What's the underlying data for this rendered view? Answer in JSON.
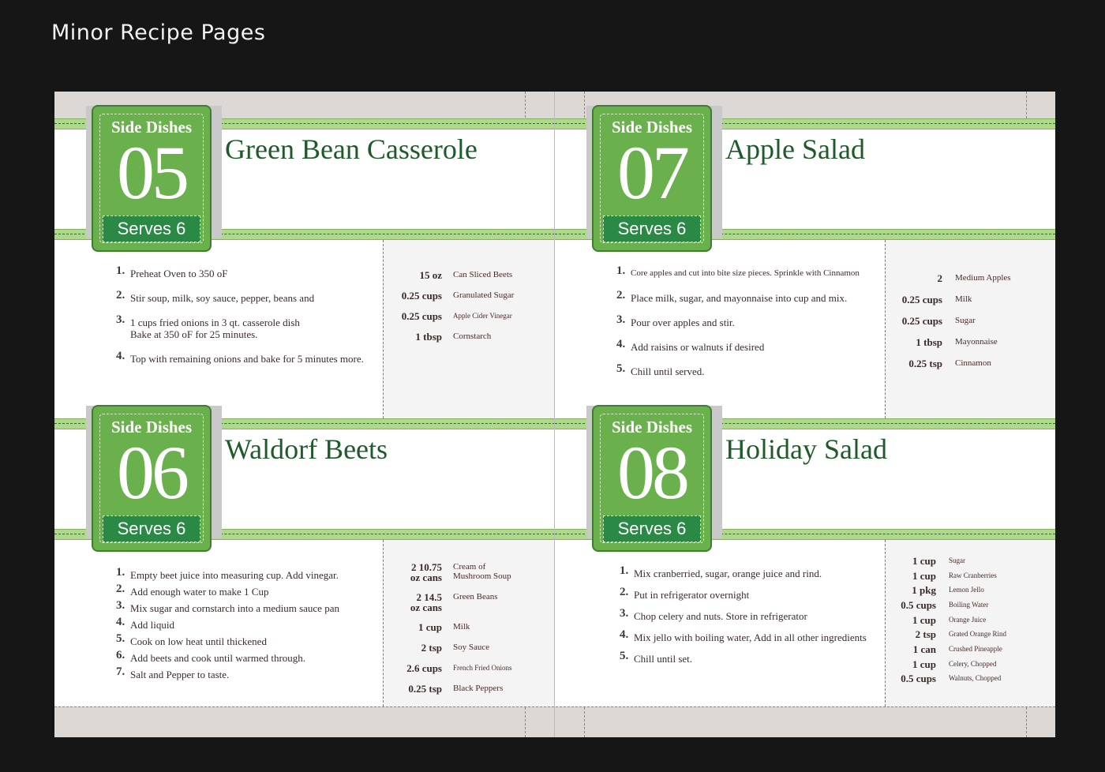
{
  "page_title": "Minor Recipe Pages",
  "recipes": [
    {
      "category": "Side Dishes",
      "number": "05",
      "serves": "Serves 6",
      "title": "Green Bean Casserole",
      "steps": [
        {
          "n": "1.",
          "text": "Preheat Oven to 350 oF"
        },
        {
          "n": "2.",
          "text": "Stir soup, milk, soy sauce, pepper, beans and"
        },
        {
          "n": "3.",
          "text": "1 cups fried onions in 3 qt. casserole dish\nBake at 350 oF for 25 minutes."
        },
        {
          "n": "4.",
          "text": "Top with remaining onions and bake for 5 minutes more."
        }
      ],
      "ingredients": [
        {
          "qty": "15 oz",
          "name": "Can Sliced Beets"
        },
        {
          "qty": "0.25 cups",
          "name": "Granulated Sugar"
        },
        {
          "qty": "0.25 cups",
          "name": "Apple Cider Vinegar"
        },
        {
          "qty": "1 tbsp",
          "name": "Cornstarch"
        }
      ]
    },
    {
      "category": "Side Dishes",
      "number": "07",
      "serves": "Serves 6",
      "title": "Apple Salad",
      "steps": [
        {
          "n": "1.",
          "text": "Core apples and cut into bite size pieces. Sprinkle with Cinnamon"
        },
        {
          "n": "2.",
          "text": "Place milk, sugar, and mayonnaise into cup and mix."
        },
        {
          "n": "3.",
          "text": "Pour over apples and stir."
        },
        {
          "n": "4.",
          "text": "Add raisins or walnuts if desired"
        },
        {
          "n": "5.",
          "text": "Chill until served."
        }
      ],
      "ingredients": [
        {
          "qty": "2",
          "name": "Medium Apples"
        },
        {
          "qty": "0.25 cups",
          "name": "Milk"
        },
        {
          "qty": "0.25 cups",
          "name": "Sugar"
        },
        {
          "qty": "1 tbsp",
          "name": "Mayonnaise"
        },
        {
          "qty": "0.25  tsp",
          "name": "Cinnamon"
        }
      ]
    },
    {
      "category": "Side Dishes",
      "number": "06",
      "serves": "Serves 6",
      "title": "Waldorf Beets",
      "steps": [
        {
          "n": "1.",
          "text": "Empty beet juice into measuring cup.  Add vinegar."
        },
        {
          "n": "2.",
          "text": "Add enough water to make 1 Cup"
        },
        {
          "n": "3.",
          "text": "Mix sugar and cornstarch into a medium sauce pan"
        },
        {
          "n": "4.",
          "text": "Add liquid"
        },
        {
          "n": "5.",
          "text": "Cook on low heat until thickened"
        },
        {
          "n": "6.",
          "text": "Add beets and cook until warmed through."
        },
        {
          "n": "7.",
          "text": "Salt and Pepper to taste."
        }
      ],
      "ingredients": [
        {
          "qty": "2 10.75\noz cans",
          "name": "Cream of\nMushroom Soup"
        },
        {
          "qty": "2 14.5\noz cans",
          "name": "Green Beans"
        },
        {
          "qty": "1 cup",
          "name": "Milk"
        },
        {
          "qty": "2 tsp",
          "name": "Soy Sauce"
        },
        {
          "qty": "2.6 cups",
          "name": "French Fried Onions"
        },
        {
          "qty": "0.25 tsp",
          "name": "Black Peppers"
        }
      ]
    },
    {
      "category": "Side Dishes",
      "number": "08",
      "serves": "Serves 6",
      "title": "Holiday Salad",
      "steps": [
        {
          "n": "1.",
          "text": "Mix cranberried, sugar, orange juice and rind."
        },
        {
          "n": "2.",
          "text": "Put in refrigerator overnight"
        },
        {
          "n": "3.",
          "text": "Chop celery and nuts. Store in refrigerator"
        },
        {
          "n": "4.",
          "text": "Mix jello with boiling water, Add in all other ingredients"
        },
        {
          "n": "5.",
          "text": "Chill until set."
        }
      ],
      "ingredients": [
        {
          "qty": "1 cup",
          "name": "Sugar"
        },
        {
          "qty": "1 cup",
          "name": "Raw Cranberries"
        },
        {
          "qty": "1 pkg",
          "name": "Lemon Jello"
        },
        {
          "qty": "0.5 cups",
          "name": "Boiling Water"
        },
        {
          "qty": "1 cup",
          "name": "Orange Juice"
        },
        {
          "qty": "2 tsp",
          "name": "Grated Orange Rind"
        },
        {
          "qty": "1 can",
          "name": "Crushed Pineapple"
        },
        {
          "qty": "1 cup",
          "name": "Celery, Chopped"
        },
        {
          "qty": "0.5 cups",
          "name": "Walnuts, Chopped"
        }
      ]
    }
  ]
}
